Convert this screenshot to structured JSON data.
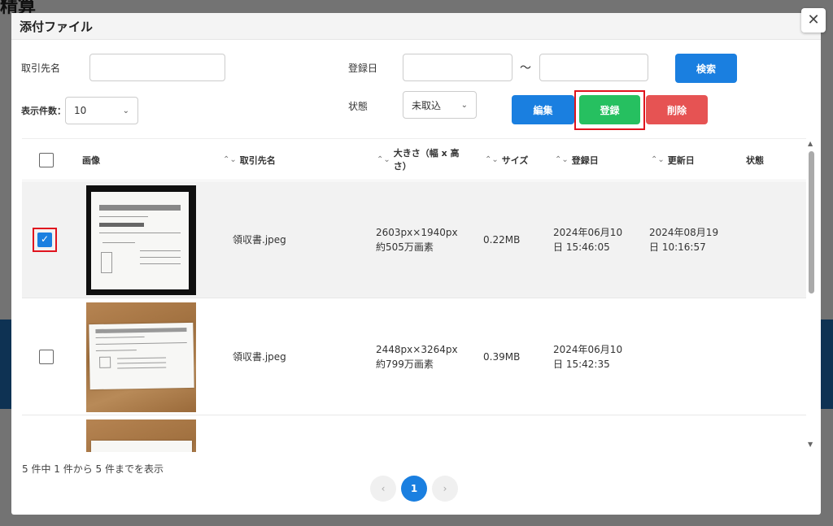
{
  "background": {
    "title": "精算",
    "accent": "#1f6fb8"
  },
  "modal": {
    "title": "添付ファイル",
    "close_icon": "close-icon"
  },
  "filters": {
    "partner_label": "取引先名",
    "partner_value": "",
    "date_label": "登録日",
    "date_from": "",
    "date_tilde": "〜",
    "date_to": "",
    "search_label": "検索",
    "per_page_label": "表示件数：",
    "per_page_value": "10",
    "status_label": "状態",
    "status_value": "未取込"
  },
  "actions": {
    "edit_label": "編集",
    "register_label": "登録",
    "delete_label": "削除"
  },
  "table": {
    "headers": {
      "image": "画像",
      "partner": "取引先名",
      "size_dims": "大きさ（幅 x 高さ）",
      "filesize": "サイズ",
      "registered": "登録日",
      "updated": "更新日",
      "status": "状態"
    },
    "rows": [
      {
        "checked": true,
        "name": "領収書.jpeg",
        "dims1": "2603px×1940px",
        "dims2": "約505万画素",
        "filesize": "0.22MB",
        "reg1": "2024年06月10",
        "reg2": "日 15:46:05",
        "upd1": "2024年08月19",
        "upd2": "日 10:16:57",
        "status": ""
      },
      {
        "checked": false,
        "name": "領収書.jpeg",
        "dims1": "2448px×3264px",
        "dims2": "約799万画素",
        "filesize": "0.39MB",
        "reg1": "2024年06月10",
        "reg2": "日 15:42:35",
        "upd1": "",
        "upd2": "",
        "status": ""
      }
    ]
  },
  "pagination": {
    "summary": "5 件中 1 件から 5 件までを表示",
    "prev": "‹",
    "current": "1",
    "next": "›"
  }
}
